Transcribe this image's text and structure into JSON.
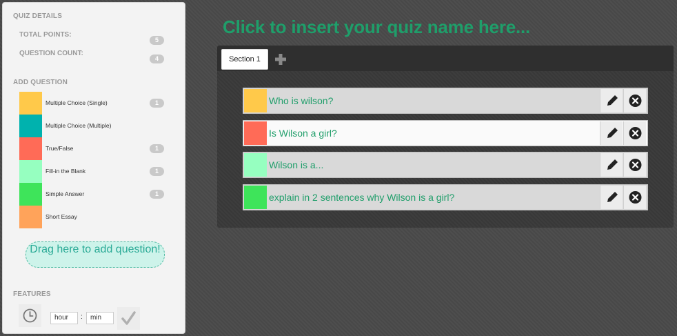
{
  "sidebar": {
    "quiz_details_heading": "QUIZ DETAILS",
    "total_points_label": "TOTAL POINTS:",
    "total_points_value": "5",
    "question_count_label": "QUESTION COUNT:",
    "question_count_value": "4",
    "add_question_heading": "ADD QUESTION",
    "question_types": [
      {
        "label": "Multiple Choice (Single)",
        "count": "1",
        "color": "#ffc94a"
      },
      {
        "label": "Multiple Choice (Multiple)",
        "count": "",
        "color": "#00b2ae"
      },
      {
        "label": "True/False",
        "count": "1",
        "color": "#ff6b57"
      },
      {
        "label": "Fill-in the Blank",
        "count": "1",
        "color": "#96ffc0"
      },
      {
        "label": "Simple Answer",
        "count": "1",
        "color": "#3ee45a"
      },
      {
        "label": "Short Essay",
        "count": "",
        "color": "#ffa35a"
      }
    ],
    "dropzone_text": "Drag here to add question!",
    "features_heading": "FEATURES",
    "hour_value": "hour",
    "min_value": "min",
    "colon": ":"
  },
  "main": {
    "quiz_title": "Click to insert your quiz name here...",
    "tabs": [
      {
        "label": "Section 1"
      }
    ],
    "questions": [
      {
        "text": "Who is wilson?",
        "color": "#ffc94a"
      },
      {
        "text": "Is Wilson a girl?",
        "color": "#ff6b57"
      },
      {
        "text": "Wilson is a...",
        "color": "#96ffc0"
      },
      {
        "text": "explain in 2 sentences why Wilson is a girl?",
        "color": "#3ee45a"
      }
    ]
  },
  "icons": {
    "add_tab": "plus-icon",
    "edit": "pencil-icon",
    "delete": "close-circle-icon",
    "timer": "clock-icon",
    "confirm": "checkmark-icon"
  }
}
